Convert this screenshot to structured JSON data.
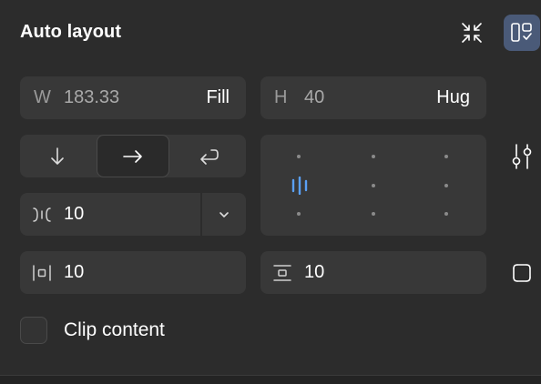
{
  "panel": {
    "title": "Auto layout",
    "icons": {
      "collapse": "collapse-arrows-icon",
      "layout_toggle": "auto-layout-checklist-icon",
      "settings": "sliders-icon",
      "padding_mode": "independent-padding-icon"
    },
    "accent_color": "#4a5a78"
  },
  "size": {
    "width": {
      "prefix": "W",
      "value": "183.33",
      "mode": "Fill"
    },
    "height": {
      "prefix": "H",
      "value": "40",
      "mode": "Hug"
    }
  },
  "direction": {
    "options": [
      "vertical",
      "horizontal",
      "wrap"
    ],
    "selected": "horizontal"
  },
  "gap": {
    "value": "10"
  },
  "alignment": {
    "selected": "left-center"
  },
  "padding": {
    "horizontal": "10",
    "vertical": "10"
  },
  "clip_content": {
    "label": "Clip content",
    "checked": false
  }
}
